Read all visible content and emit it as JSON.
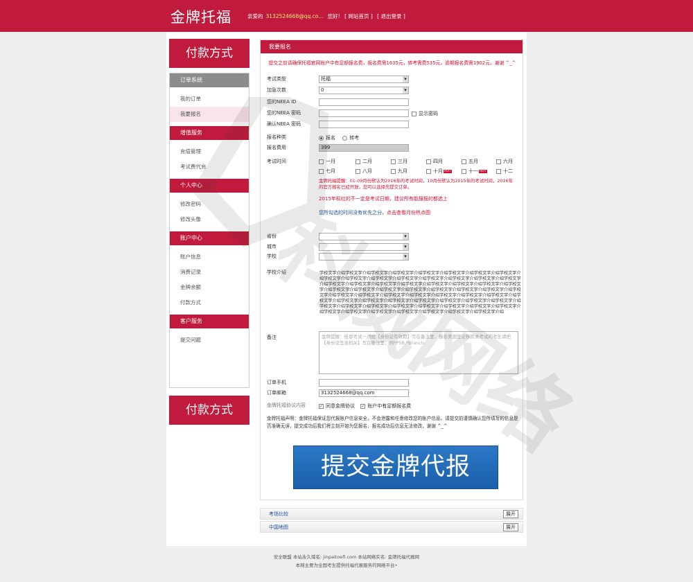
{
  "header": {
    "brand": "金牌托福",
    "greeting_prefix": "亲爱的",
    "user_email": "3132524668@qq.co...",
    "greeting_suffix": "您好!",
    "home_link": "[ 网站首页 ]",
    "logout_link": "[ 退出登录 ]"
  },
  "sidebar": {
    "pay_title": "付款方式",
    "sections": [
      {
        "title": "订单系统",
        "items": [
          "我的订单",
          "我要报名"
        ]
      },
      {
        "title": "增值服务",
        "items": [
          "充值管理",
          "考试费代充"
        ]
      },
      {
        "title": "个人中心",
        "items": [
          "修改密码",
          "修改头像"
        ]
      },
      {
        "title": "账户中心",
        "items": [
          "账户信息",
          "消费记录",
          "金牌余额",
          "付款方式"
        ]
      },
      {
        "title": "客户服务",
        "items": [
          "提交问题"
        ]
      }
    ],
    "pay_bottom": "付款方式"
  },
  "form": {
    "heading": "我要报名",
    "notice": "提交之前请确保托福官网账户中有足额报名费，报名费需1635元，转考需费535元，逾期报名费需1902元，谢谢 ^_^",
    "exam_type_label": "考试类型",
    "exam_type_value": "托福",
    "urgent_label": "加急次数",
    "urgent_value": "0",
    "neea_id_label": "您的NEEA ID",
    "neea_pwd_label": "您的NEEA 密码",
    "show_pwd": "显示密码",
    "confirm_pwd_label": "确认NEEA 密码",
    "reg_type_label": "报名种类",
    "reg_opt1": "报名",
    "reg_opt2": "转考",
    "fee_label": "报名费用",
    "fee_value": "399",
    "exam_time_label": "考试时间",
    "months": [
      "一月",
      "二月",
      "三月",
      "四月",
      "五月",
      "六月",
      "七月",
      "八月",
      "九月",
      "十月",
      "十一",
      "十二"
    ],
    "hot_tag": "HOT",
    "tip1": "金牌托福提醒：01-09月份默认为2016年的考试时间，10月份默认为2015年的考试时间，2016年的官方报名已经开放，您可以选择先提交订单。",
    "tip2": "2015年标红的不一定是考试日期，建议所有能搜报的都选上",
    "tip3a": "您所勾选的时间没有优先之分，",
    "tip3b": "点击查看月份热点图",
    "province_label": "省份",
    "city_label": "城市",
    "school_label": "学校",
    "school_intro_label": "学校介绍",
    "school_intro": "学校文字介绍学校文字介绍学校文字介绍学校文字介绍学校文字介绍学校文字介绍学校文字介绍学校文字介绍学校文字介绍学校文字介绍学校文字介绍学校文字介绍学校文字介绍学校文字介绍学校文字介绍学校文字介绍学校文字介绍学校文字介绍学校文字介绍学校文字介绍学校文字介绍学校文字介绍学校文字介绍学校文字介绍学校文字介绍学校文字介绍学校文字介绍学校文字介绍学校文字介绍学校文字介绍学校文字介绍学校文字介绍学校文字介绍学校文字介绍学校文字介绍学校文字介绍学校文字介绍学校文字介绍学校文字介绍学校文字介绍学校文字介绍学校文字介绍学校文字介绍学校文字介绍学校文字介绍学校文字介绍学校文字介绍学校文字介绍学校文字介绍学校文字介绍学校文字介绍学校文字介绍学校文字介绍学校文字介绍学校文字介绍学校文字介绍学校文字介绍学校文字介绍学校文字介绍学校文字介绍学校文字介绍学校文字介绍",
    "remark_label": "备注",
    "remark_placeholder": "金牌提醒：桂恩考试一须经【身份证有效期】写在备注里，报名美国签证移民类考试的考生请把【身份证签发机关】写在备注里，例*PSB,*Branch",
    "phone_label": "订单手机",
    "email_label": "订单邮箱",
    "email_value": "3132524668@qq.com",
    "agree_label": "金牌托福协议内容",
    "agree1": "同意金牌协议",
    "agree2": "账户中有足额报名费",
    "statement": "金牌托福声明：金牌托福保证您代报账户信息安全，不会泄露和任意修改您的账户信息。请提交前谨慎确认您所填写的信息是否准确无误，提交成功后我们将立刻开始为您报名，报名成功后信息无法修改，谢谢 ^_^",
    "submit_label": "提交金牌代报"
  },
  "accordions": [
    {
      "title": "考场比较",
      "btn": "展开"
    },
    {
      "title": "中国地图",
      "btn": "展开"
    }
  ],
  "footer": {
    "line1": "安全联盟  本站永久域名: jinpaitoefl.com  本站网络实名: 金牌托福代报网",
    "line2": "本网主要为全国考生提供托福代报服务的网络平台•"
  },
  "watermark": "科威网络"
}
